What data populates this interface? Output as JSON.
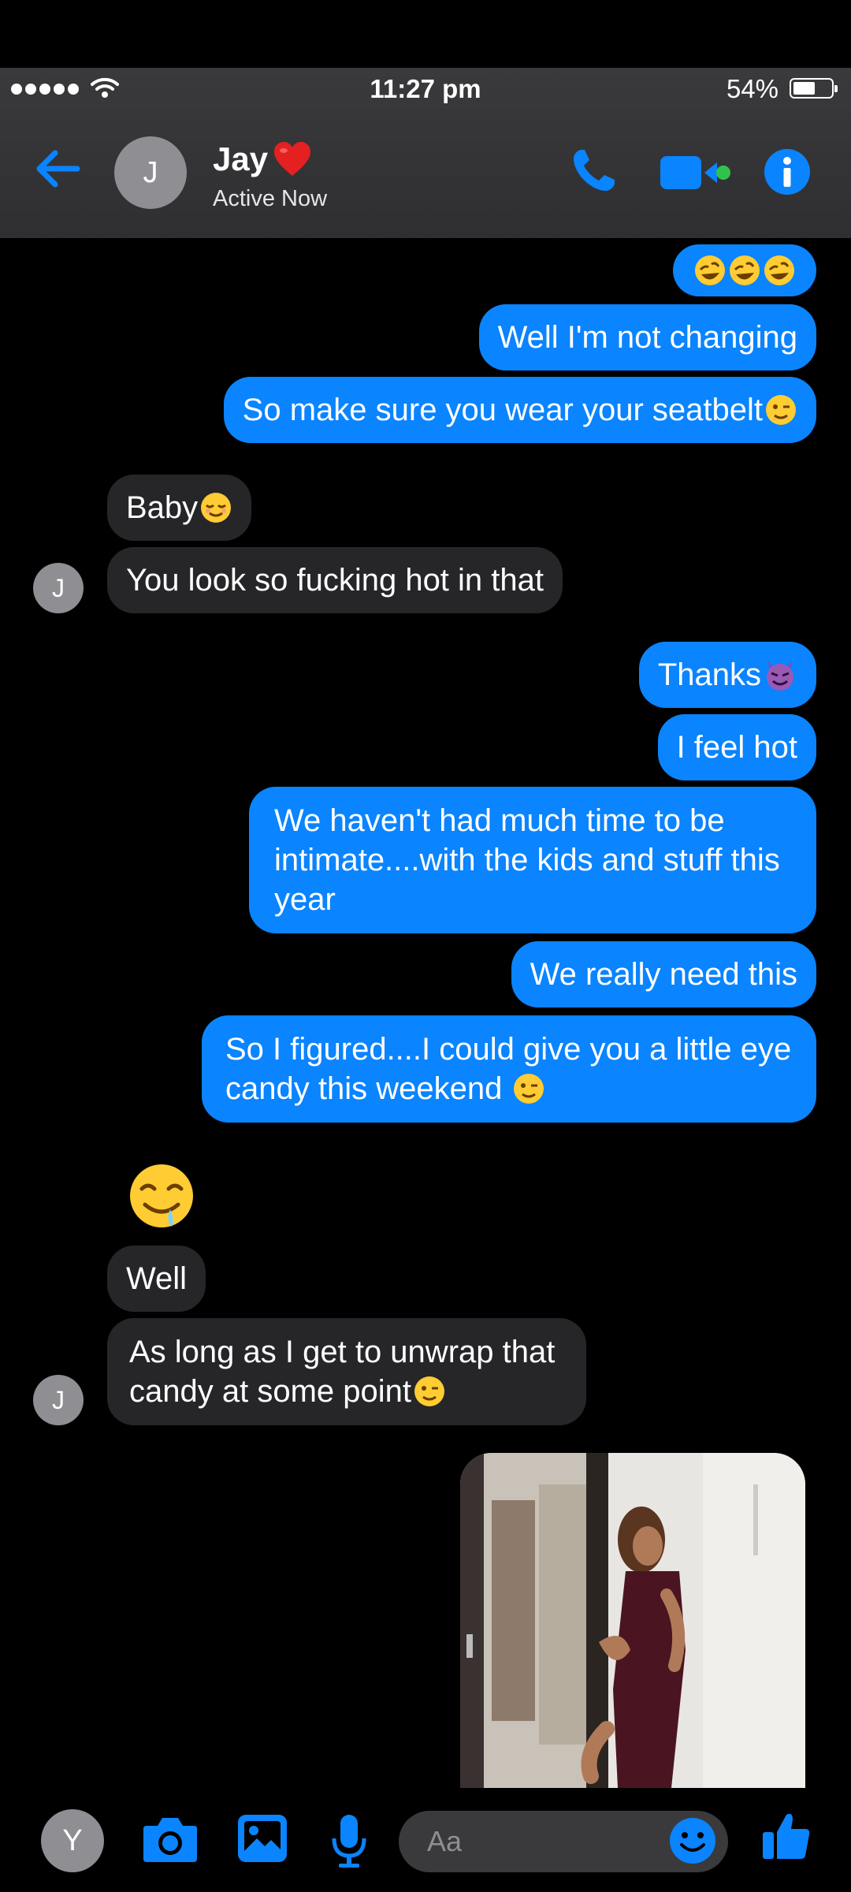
{
  "status_bar": {
    "time": "11:27 pm",
    "battery": "54%"
  },
  "header": {
    "contact_name": "Jay",
    "contact_initial": "J",
    "status": "Active Now"
  },
  "messages": [
    {
      "id": "m1",
      "side": "out",
      "text": "",
      "emoji": [
        "rofl",
        "rofl",
        "rofl"
      ]
    },
    {
      "id": "m2",
      "side": "out",
      "text": "Well I'm not changing"
    },
    {
      "id": "m3",
      "side": "out",
      "text": "So make sure you wear your seatbelt",
      "emoji": [
        "wink"
      ]
    },
    {
      "id": "m4",
      "side": "in",
      "text": "Baby",
      "emoji": [
        "relieved"
      ]
    },
    {
      "id": "m5",
      "side": "in",
      "text": "You look so fucking hot in that"
    },
    {
      "id": "m6",
      "side": "out",
      "text": "Thanks",
      "emoji": [
        "devil"
      ]
    },
    {
      "id": "m7",
      "side": "out",
      "text": "I feel hot"
    },
    {
      "id": "m8",
      "side": "out",
      "lines": [
        "We haven't had much time to be",
        "intimate....with the kids and stuff this",
        "year"
      ]
    },
    {
      "id": "m9",
      "side": "out",
      "text": "We really need this"
    },
    {
      "id": "m10",
      "side": "out",
      "lines": [
        "So I figured....I could give you a little eye",
        "candy this weekend "
      ],
      "emoji": [
        "wink"
      ]
    },
    {
      "id": "m11",
      "side": "in",
      "emoji_only": "drooling"
    },
    {
      "id": "m12",
      "side": "in",
      "text": "Well"
    },
    {
      "id": "m13",
      "side": "in",
      "lines": [
        "As long as I get to unwrap that",
        "candy at some point"
      ],
      "emoji": [
        "wink"
      ]
    },
    {
      "id": "m14",
      "side": "out",
      "image": "photo-woman-dress"
    }
  ],
  "composer": {
    "user_initial": "Y",
    "placeholder": "Aa"
  },
  "colors": {
    "accent": "#0a84ff",
    "incoming": "#262629",
    "header": "#353537"
  }
}
